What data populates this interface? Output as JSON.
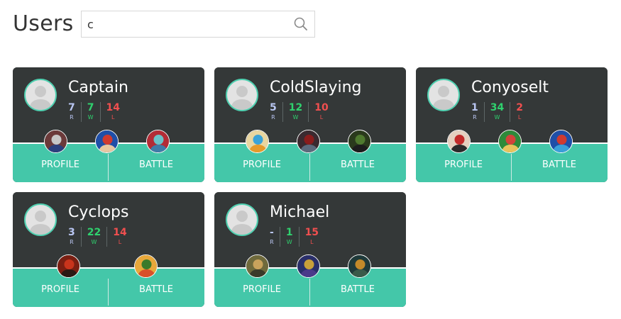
{
  "page": {
    "title": "Users"
  },
  "search": {
    "value": "c",
    "placeholder": ""
  },
  "users": [
    {
      "name": "Captain",
      "r": "7",
      "w": "7",
      "l": "14",
      "heroes": [
        {
          "colors": [
            "#6b3a3a",
            "#c7c7c7",
            "#2b3f7d"
          ]
        },
        {
          "colors": [
            "#1f4fa8",
            "#d03a2f",
            "#e7c6a0"
          ]
        },
        {
          "colors": [
            "#b32c36",
            "#6ac2c8",
            "#3e7ca8"
          ]
        }
      ]
    },
    {
      "name": "ColdSlaying",
      "r": "5",
      "w": "12",
      "l": "10",
      "heroes": [
        {
          "colors": [
            "#e8d6a0",
            "#3aa3d8",
            "#e59a2a"
          ]
        },
        {
          "colors": [
            "#3a2a30",
            "#8a1c1c",
            "#5c6a7c"
          ]
        },
        {
          "colors": [
            "#2a3a1c",
            "#4f7a2f",
            "#1c1c1c"
          ]
        }
      ]
    },
    {
      "name": "Conyoselt",
      "r": "1",
      "w": "34",
      "l": "2",
      "heroes": [
        {
          "colors": [
            "#e5d0c0",
            "#c22a2a",
            "#2b2b2b"
          ]
        },
        {
          "colors": [
            "#2e8a3a",
            "#d4433a",
            "#e8c35c"
          ]
        },
        {
          "colors": [
            "#1f4fa8",
            "#d03a2f",
            "#3a9fd8"
          ]
        }
      ]
    },
    {
      "name": "Cyclops",
      "r": "3",
      "w": "22",
      "l": "14",
      "heroes": [
        {
          "colors": [
            "#7a1f12",
            "#c8341c",
            "#2b1a14"
          ]
        },
        {
          "colors": [
            "#e8a83a",
            "#3a7a2a",
            "#d8502a"
          ]
        }
      ]
    },
    {
      "name": "Michael",
      "r": "-",
      "w": "1",
      "l": "15",
      "heroes": [
        {
          "colors": [
            "#6f6a3c",
            "#c9a35c",
            "#3a3a2a"
          ]
        },
        {
          "colors": [
            "#2a2f6a",
            "#c9a03a",
            "#4a3a8a"
          ]
        },
        {
          "colors": [
            "#1f3a3a",
            "#c28a2a",
            "#3a5a4a"
          ]
        }
      ]
    }
  ],
  "labels": {
    "r": "R",
    "w": "W",
    "l": "L",
    "profile": "PROFILE",
    "battle": "BATTLE"
  },
  "colors": {
    "card": "#343838",
    "accent": "#44c7a9",
    "rank": "#b9c6f2",
    "win": "#2fd16e",
    "loss": "#f04f4f"
  }
}
